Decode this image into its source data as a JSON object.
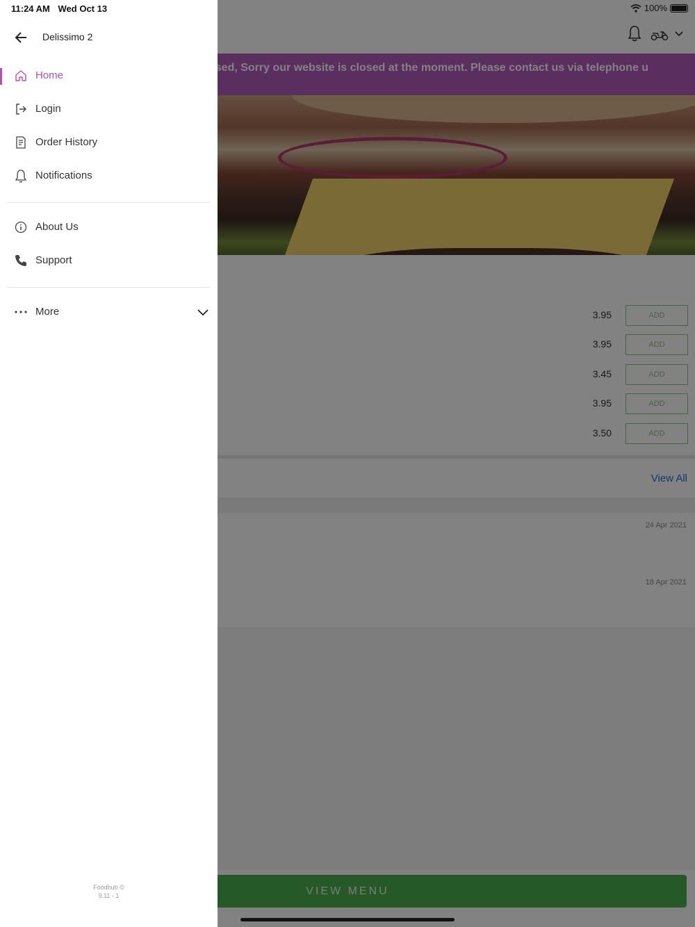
{
  "status_bar": {
    "time": "11:24 AM",
    "date": "Wed Oct 13",
    "battery": "100%"
  },
  "drawer": {
    "store_name": "Delissimo 2",
    "primary_items": [
      {
        "label": "Home",
        "icon": "home-icon",
        "active": true
      },
      {
        "label": "Login",
        "icon": "login-icon"
      },
      {
        "label": "Order History",
        "icon": "receipt-icon"
      },
      {
        "label": "Notifications",
        "icon": "bell-icon"
      }
    ],
    "secondary_items": [
      {
        "label": "About Us",
        "icon": "info-icon"
      },
      {
        "label": "Support",
        "icon": "phone-icon"
      }
    ],
    "more": {
      "label": "More",
      "icon": "dots-icon"
    },
    "footer": {
      "line1": "Foodhub ©",
      "line2": "9.11 - 1"
    },
    "accent_color": "#b24fbb"
  },
  "background": {
    "banner_text": "osed, Sorry our website is closed at the moment. Please contact us via telephone u",
    "banner_color": "#b05ab8",
    "items": [
      {
        "price": "3.95",
        "button": "ADD"
      },
      {
        "price": "3.95",
        "button": "ADD"
      },
      {
        "price": "3.45",
        "button": "ADD"
      },
      {
        "price": "3.95",
        "button": "ADD"
      },
      {
        "price": "3.50",
        "button": "ADD"
      }
    ],
    "view_all": "View All",
    "review_dates": [
      "24 Apr 2021",
      "18 Apr 2021"
    ],
    "view_menu": "VIEW MENU"
  }
}
